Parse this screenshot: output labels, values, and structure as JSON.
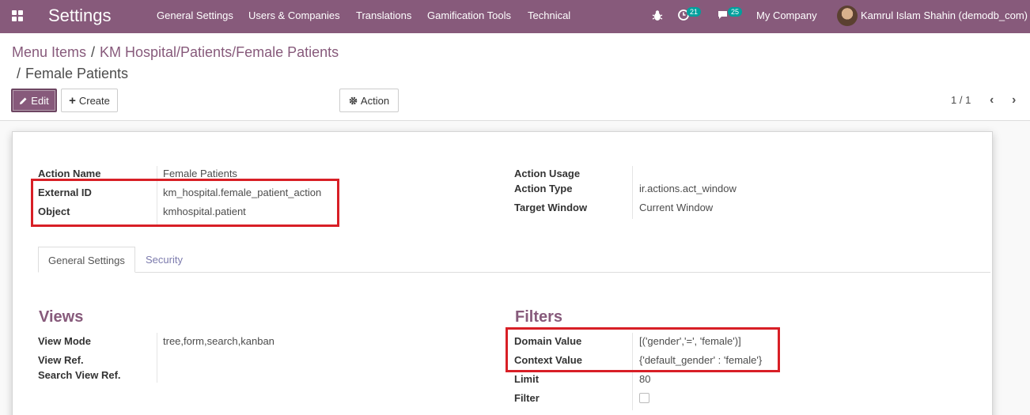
{
  "navbar": {
    "brand": "Settings",
    "menu": [
      "General Settings",
      "Users & Companies",
      "Translations",
      "Gamification Tools",
      "Technical"
    ],
    "activity_count": "21",
    "messages_count": "25",
    "company": "My Company",
    "user": "Kamrul Islam Shahin (demodb_com)"
  },
  "breadcrumb": {
    "root": "Menu Items",
    "sep1": "/",
    "parent": "KM Hospital/Patients/Female Patients",
    "sep2": "/",
    "current": "Female Patients"
  },
  "buttons": {
    "edit": "Edit",
    "create": "Create",
    "action": "Action"
  },
  "pager": {
    "value": "1 / 1"
  },
  "header_fields": {
    "action_name_label": "Action Name",
    "action_name": "Female Patients",
    "external_id_label": "External ID",
    "external_id": "km_hospital.female_patient_action",
    "object_label": "Object",
    "object": "kmhospital.patient",
    "action_usage_label": "Action Usage",
    "action_type_label": "Action Type",
    "action_type": "ir.actions.act_window",
    "target_window_label": "Target Window",
    "target_window": "Current Window"
  },
  "tabs": [
    "General Settings",
    "Security"
  ],
  "views": {
    "title": "Views",
    "view_mode_label": "View Mode",
    "view_mode": "tree,form,search,kanban",
    "view_ref_label": "View Ref.",
    "search_view_ref_label": "Search View Ref."
  },
  "filters": {
    "title": "Filters",
    "domain_label": "Domain Value",
    "domain": "[('gender','=', 'female')]",
    "context_label": "Context Value",
    "context": "{'default_gender' : 'female'}",
    "limit_label": "Limit",
    "limit": "80",
    "filter_label": "Filter",
    "filter_checked": false
  },
  "colors": {
    "brand": "#875a7b",
    "highlight": "#d81f26",
    "badge": "#00a09d"
  }
}
